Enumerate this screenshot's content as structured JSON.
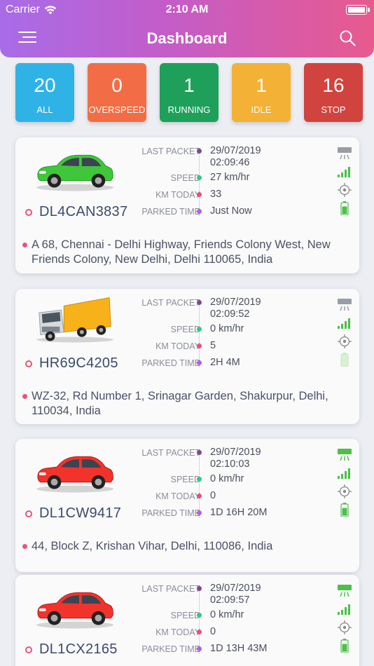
{
  "status_bar": {
    "carrier": "Carrier",
    "time": "2:10 AM"
  },
  "header": {
    "title": "Dashboard",
    "menu_icon": "hamburger-menu-icon",
    "search_icon": "search-icon"
  },
  "colors": {
    "all": "#2fb3e6",
    "overspeed": "#f26d45",
    "running": "#1fa05a",
    "idle": "#f3b135",
    "stop": "#d1433e",
    "accent": "#e8547a"
  },
  "tiles": [
    {
      "count": "20",
      "label": "ALL"
    },
    {
      "count": "0",
      "label": "OVERSPEED"
    },
    {
      "count": "1",
      "label": "RUNNING"
    },
    {
      "count": "1",
      "label": "IDLE"
    },
    {
      "count": "16",
      "label": "STOP"
    }
  ],
  "field_labels": {
    "last_packet": "LAST PACKET",
    "speed": "SPEED",
    "km_today": "KM TODAY",
    "parked_time": "PARKED TIME"
  },
  "vehicles": [
    {
      "plate": "DL4CAN3837",
      "type": "car",
      "color": "green",
      "last_packet_date": "29/07/2019",
      "last_packet_time": "02:09:46",
      "speed": "27 km/hr",
      "km_today": "33",
      "parked_time": "Just Now",
      "address": "A 68, Chennai - Delhi Highway, Friends Colony West, New Friends Colony, New Delhi, Delhi 110065, India",
      "ac_on": false,
      "battery_level": 0.8
    },
    {
      "plate": "HR69C4205",
      "type": "truck",
      "color": "yellow",
      "last_packet_date": "29/07/2019",
      "last_packet_time": "02:09:52",
      "speed": "0 km/hr",
      "km_today": "5",
      "parked_time": "2H 4M",
      "address": "WZ-32, Rd Number 1, Srinagar Garden, Shakurpur, Delhi, 110034, India",
      "ac_on": false,
      "battery_level": 0.0
    },
    {
      "plate": "DL1CW9417",
      "type": "car",
      "color": "red",
      "last_packet_date": "29/07/2019",
      "last_packet_time": "02:10:03",
      "speed": "0 km/hr",
      "km_today": "0",
      "parked_time": "1D 16H 20M",
      "address": "44, Block Z, Krishan Vihar, Delhi, 110086, India",
      "ac_on": true,
      "battery_level": 0.8
    },
    {
      "plate": "DL1CX2165",
      "type": "car",
      "color": "red",
      "last_packet_date": "29/07/2019",
      "last_packet_time": "02:09:57",
      "speed": "0 km/hr",
      "km_today": "0",
      "parked_time": "1D 13H 43M",
      "address": "",
      "ac_on": true,
      "battery_level": 0.8
    }
  ]
}
